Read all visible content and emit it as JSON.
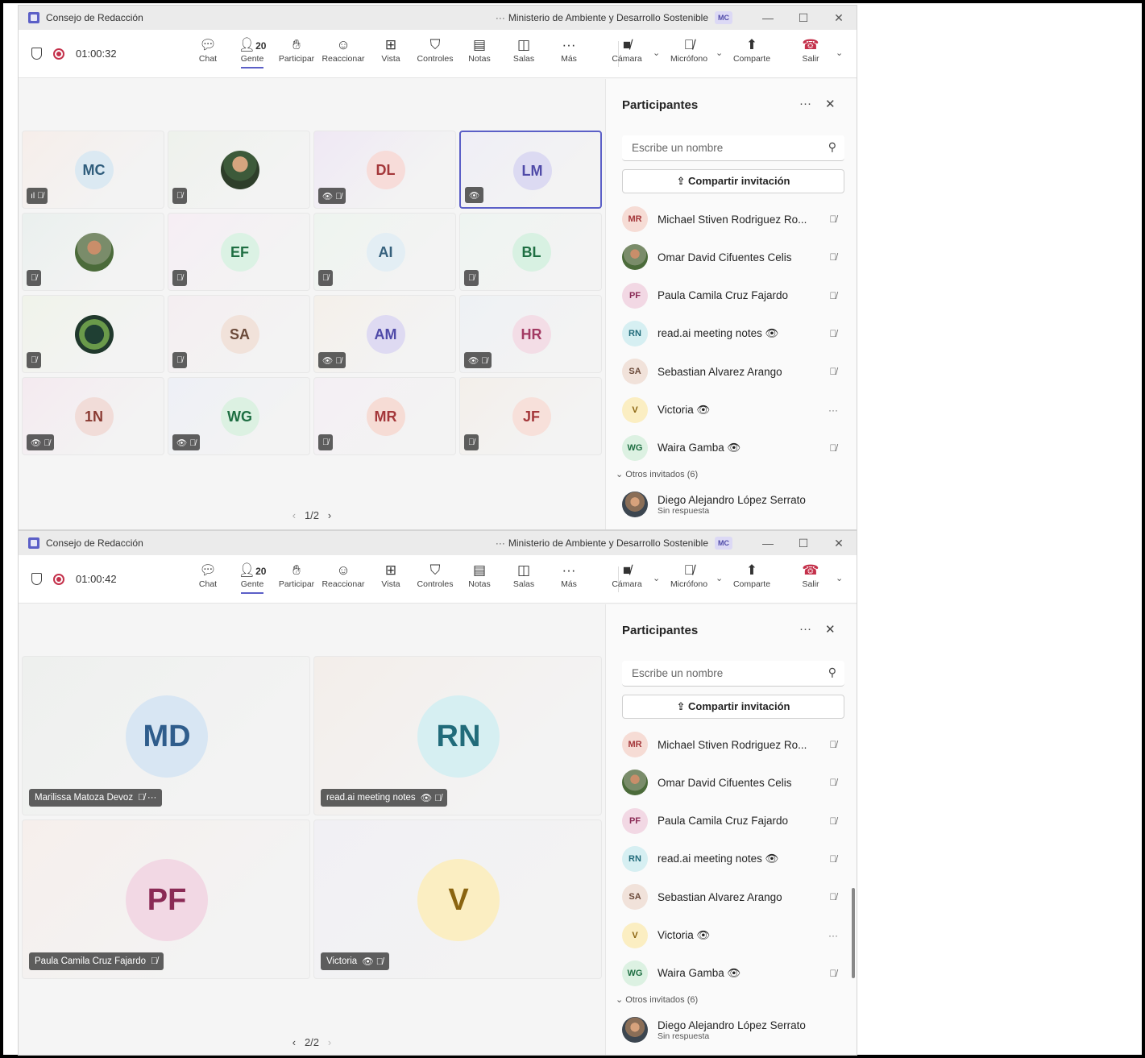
{
  "titlebar": {
    "title": "Consejo de Redacción",
    "dots": "···",
    "org": "Ministerio de Ambiente y Desarrollo Sostenible",
    "avatar": "MC",
    "minimize": "—",
    "maximize": "☐",
    "close": "✕"
  },
  "toolbar": {
    "timers": [
      "01:00:32",
      "01:00:42"
    ],
    "people_count": "20",
    "buttons": {
      "chat": "Chat",
      "people": "Gente",
      "raise": "Participar",
      "react": "Reaccionar",
      "view": "Vista",
      "controls": "Controles",
      "notes": "Notas",
      "rooms": "Salas",
      "more": "Más",
      "camera": "Cámara",
      "mic": "Micrófono",
      "share": "Comparte",
      "leave": "Salir"
    }
  },
  "grid_page1": {
    "tiles": [
      {
        "initials": "MC",
        "bg": "#dbe9f2",
        "fg": "#2f5d7c",
        "tile": "#f6eeea",
        "badge": "ıl 🎙̸",
        "photo": ""
      },
      {
        "initials": "",
        "bg": "",
        "fg": "",
        "tile": "#eef2ec",
        "badge": "🎙̸",
        "photo": "photo"
      },
      {
        "initials": "DL",
        "bg": "#f7dcd9",
        "fg": "#a4373a",
        "tile": "#efe8f4",
        "badge": "👁 🎙̸",
        "photo": ""
      },
      {
        "initials": "LM",
        "bg": "#dcdaf2",
        "fg": "#4f4aa8",
        "tile": "#efeef6",
        "badge": "👁",
        "photo": ""
      },
      {
        "initials": "",
        "bg": "",
        "fg": "",
        "tile": "#eaf0ee",
        "badge": "🎙̸",
        "photo": "photo2"
      },
      {
        "initials": "EF",
        "bg": "#dbf2e4",
        "fg": "#1f6f43",
        "tile": "#f6eef4",
        "badge": "🎙̸",
        "photo": ""
      },
      {
        "initials": "AI",
        "bg": "#e3eef4",
        "fg": "#35607c",
        "tile": "#eef4ef",
        "badge": "🎙̸",
        "photo": ""
      },
      {
        "initials": "BL",
        "bg": "#d8f1e2",
        "fg": "#1f6f43",
        "tile": "#eef4f1",
        "badge": "🎙̸",
        "photo": ""
      },
      {
        "initials": "",
        "bg": "",
        "fg": "",
        "tile": "#f0f3ea",
        "badge": "🎙̸",
        "photo": "photo3"
      },
      {
        "initials": "SA",
        "bg": "#f1e2da",
        "fg": "#6b4a3a",
        "tile": "#f4eef1",
        "badge": "🎙̸",
        "photo": ""
      },
      {
        "initials": "AM",
        "bg": "#dedaf2",
        "fg": "#4f4aa8",
        "tile": "#f4f0ea",
        "badge": "👁 🎙̸",
        "photo": ""
      },
      {
        "initials": "HR",
        "bg": "#f3dde6",
        "fg": "#a33a63",
        "tile": "#eef1f4",
        "badge": "👁 🎙̸",
        "photo": ""
      },
      {
        "initials": "1N",
        "bg": "#f1dcd8",
        "fg": "#8a3a32",
        "tile": "#f4eaf0",
        "badge": "👁 🎙̸",
        "photo": ""
      },
      {
        "initials": "WG",
        "bg": "#dcf1e2",
        "fg": "#1f6f43",
        "tile": "#eef0f6",
        "badge": "👁 🎙̸",
        "photo": ""
      },
      {
        "initials": "MR",
        "bg": "#f6dcd5",
        "fg": "#a4373a",
        "tile": "#f4eff4",
        "badge": "🎙̸",
        "photo": ""
      },
      {
        "initials": "JF",
        "bg": "#f7e0da",
        "fg": "#a4373a",
        "tile": "#f3efea",
        "badge": "🎙̸",
        "photo": ""
      }
    ],
    "pager": "1/2"
  },
  "grid_page2": {
    "tiles": [
      {
        "initials": "MD",
        "bg": "#d8e6f3",
        "fg": "#2f5d8c",
        "tile": "#eef0ee",
        "label": "Marilissa Matoza Devoz",
        "icons": "🎙̸ ···"
      },
      {
        "initials": "RN",
        "bg": "#d6eff2",
        "fg": "#216b7a",
        "tile": "#f3eeea",
        "label": "read.ai meeting notes",
        "icons": "👁 🎙̸"
      },
      {
        "initials": "PF",
        "bg": "#f2d8e4",
        "fg": "#8a2a55",
        "tile": "#f6efec",
        "label": "Paula Camila Cruz Fajardo",
        "icons": "🎙̸"
      },
      {
        "initials": "V",
        "bg": "#fbeec2",
        "fg": "#8a6410",
        "tile": "#f1f0f4",
        "label": "Victoria",
        "icons": "👁 🎙̸"
      }
    ],
    "pager": "2/2"
  },
  "panel": {
    "title": "Participantes",
    "more": "···",
    "close": "✕",
    "search_placeholder": "Escribe un nombre",
    "invite": "Compartir invitación",
    "people": [
      {
        "initials": "MR",
        "name": "Michael Stiven Rodriguez Ro...",
        "bg": "#f6dcd5",
        "fg": "#a4373a",
        "mic": "🎙̸",
        "photo": ""
      },
      {
        "initials": "",
        "name": "Omar David Cifuentes Celis",
        "bg": "",
        "fg": "",
        "mic": "🎙̸",
        "photo": "photo2"
      },
      {
        "initials": "PF",
        "name": "Paula Camila Cruz Fajardo",
        "bg": "#f2d8e4",
        "fg": "#8a2a55",
        "mic": "🎙̸",
        "photo": ""
      },
      {
        "initials": "RN",
        "name": "read.ai meeting notes 👁",
        "bg": "#d6eff2",
        "fg": "#216b7a",
        "mic": "🎙̸",
        "photo": ""
      },
      {
        "initials": "SA",
        "name": "Sebastian Alvarez Arango",
        "bg": "#f1e2da",
        "fg": "#6b4a3a",
        "mic": "🎙̸",
        "photo": ""
      },
      {
        "initials": "V",
        "name": "Victoria 👁",
        "bg": "#fbeec2",
        "fg": "#8a6410",
        "mic": "···",
        "photo": ""
      },
      {
        "initials": "WG",
        "name": "Waira Gamba 👁",
        "bg": "#dcf1e2",
        "fg": "#1f6f43",
        "mic": "🎙̸",
        "photo": ""
      }
    ],
    "section": "Otros invitados (6)",
    "guest": {
      "name": "Diego Alejandro López Serrato",
      "status": "Sin respuesta"
    }
  }
}
